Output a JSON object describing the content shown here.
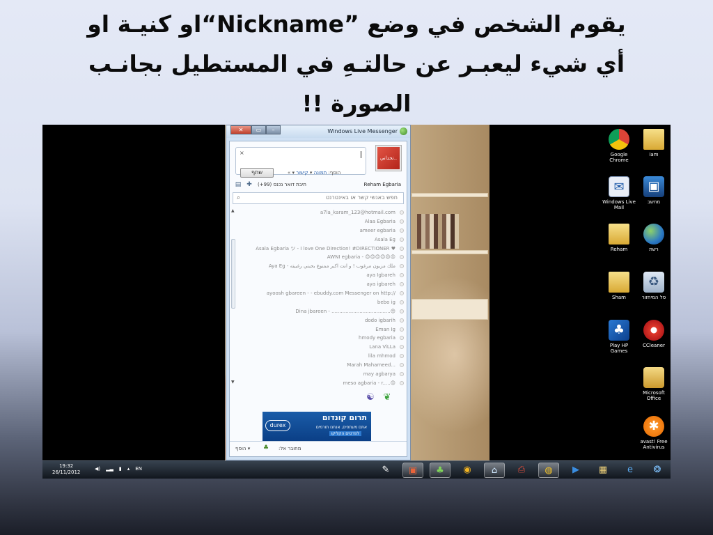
{
  "slide": {
    "line1": "يقوم الشخص في وضع   ”Nickname“او كنيـة او",
    "line2": "أي شيء ليعبـر عن حالتـهِ في المستطيل بجانـب",
    "line3": "الصورة !!"
  },
  "messenger": {
    "title": "Windows Live Messenger",
    "close_label": "✕",
    "restore_label": "▭",
    "minimize_label": "–",
    "status_close": "×",
    "share_label": "שתף",
    "add_label": "הוסף:",
    "photo_link": "תמונה",
    "link_link": "קישור",
    "more_link": "»",
    "avatar_text": "تحداني..",
    "me_name": "Reham Egbaria",
    "mail_count": "תיבת דואר נכנס (99+)",
    "search_placeholder": "חפש באנשי קשר או באינטרנט",
    "contacts": [
      "a7la_karam_123@hotmail.com",
      "Alaa Egbaria",
      "ameer egbaria",
      "Asala Eg",
      "Asala Egbaria ツ - I love One Direction! #DIRECTIONER ♥",
      "AWNI egbaria - 😊😊😊😊😍😍",
      "Aya Eg - ملك مزيون مرغوب ! و انت اكبر ممنوع بحبني رغبيته",
      "aya Igbareh",
      "aya igbareh",
      "ayoosh gbareen - - ebuddy.com Messenger on http://",
      "bebo ig",
      "Dina jbareen - ......................................😊",
      "dodo igbarih",
      "Eman Ig",
      "hmody egbaria",
      "Lana ViLLa",
      "lila mhmod",
      "Marah Mahameed...",
      "may agbarya",
      "meso agbaria - r.....😊",
      "Mhmad Igb"
    ],
    "ad": {
      "logo": "durex",
      "title": "תרום קונדום",
      "sub": "אתם מעתפים, אנחנו תורמים",
      "cta": "לפרטים הקליקו"
    },
    "footer_connected": "מחובר אל:",
    "footer_add": "הוסף"
  },
  "desktop": {
    "icons": [
      {
        "name": "iam",
        "label": "iam"
      },
      {
        "name": "google-chrome",
        "label": "Google Chrome"
      },
      {
        "name": "computer",
        "label": "מחשב"
      },
      {
        "name": "windows-live-mail",
        "label": "Windows Live Mail"
      },
      {
        "name": "network",
        "label": "רשת"
      },
      {
        "name": "reham",
        "label": "Reham"
      },
      {
        "name": "recycle-bin",
        "label": "סל המיחזור"
      },
      {
        "name": "sham",
        "label": "Sham"
      },
      {
        "name": "ccleaner",
        "label": "CCleaner"
      },
      {
        "name": "play-hp-games",
        "label": "Play HP Games"
      },
      {
        "name": "microsoft-office",
        "label": "Microsoft Office"
      },
      {
        "name": "avast",
        "label": "avast! Free Antivirus"
      }
    ]
  },
  "taskbar": {
    "time": "19:32",
    "date": "26/11/2012",
    "lang": "EN"
  },
  "icons": {
    "chrome": "chrome-icon",
    "folder": "folder-icon",
    "mail": "mail-icon",
    "computer": "computer-icon",
    "network": "globe-icon",
    "bin": "recycle-bin-icon"
  }
}
